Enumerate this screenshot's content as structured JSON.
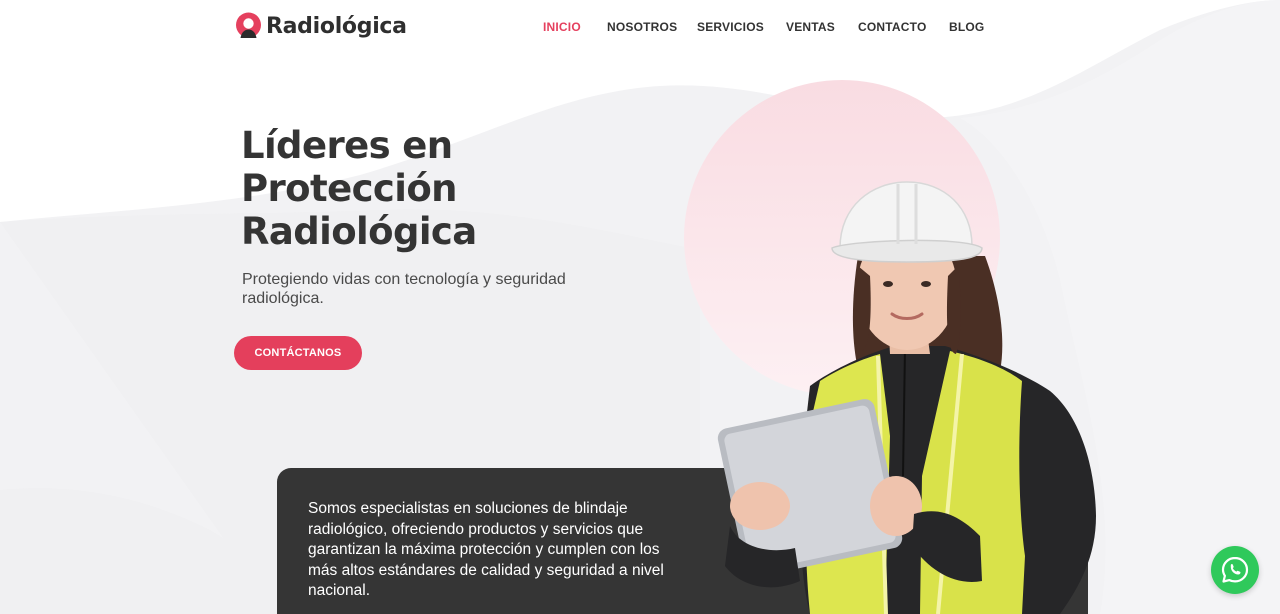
{
  "brand": {
    "name": "Radiológica"
  },
  "nav": {
    "items": [
      {
        "label": "INICIO",
        "active": true
      },
      {
        "label": "NOSOTROS",
        "active": false
      },
      {
        "label": "SERVICIOS",
        "active": false
      },
      {
        "label": "VENTAS",
        "active": false
      },
      {
        "label": "CONTACTO",
        "active": false
      },
      {
        "label": "BLOG",
        "active": false
      }
    ]
  },
  "hero": {
    "title_lines": [
      "Líderes en",
      "Protección",
      "Radiológica"
    ],
    "subtitle": "Protegiendo vidas con tecnología y seguridad radiológica.",
    "cta_label": "CONTÁCTANOS"
  },
  "intro": {
    "text": "Somos especialistas en soluciones de blindaje radiológico, ofreciendo productos y servicios que garantizan la máxima protección y cumplen con los más altos estándares de calidad y seguridad a nivel nacional."
  },
  "icons": {
    "logo_mark": "location-pin-person-icon",
    "floating_action": "whatsapp-icon"
  },
  "colors": {
    "accent": "#e5405e",
    "cta": "#e43f5c",
    "dark_panel": "#353535",
    "background_wave": "#f1f1f3",
    "pink_circle": "#fbe6ea",
    "whatsapp": "#2fc95b"
  }
}
